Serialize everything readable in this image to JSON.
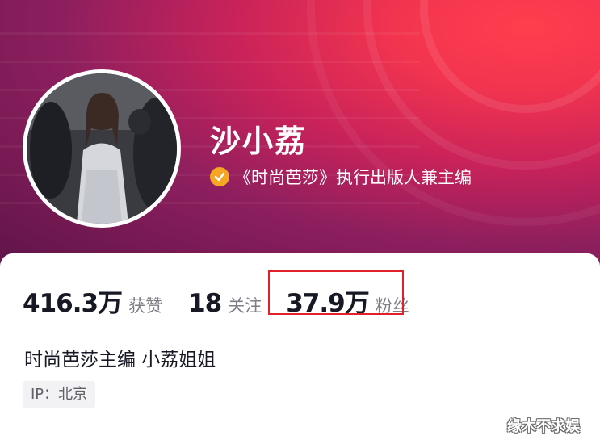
{
  "profile": {
    "name": "沙小荔",
    "verification": "《时尚芭莎》执行出版人兼主编"
  },
  "stats": {
    "likes_value": "416.3万",
    "likes_label": "获赞",
    "following_value": "18",
    "following_label": "关注",
    "fans_value": "37.9万",
    "fans_label": "粉丝"
  },
  "bio": "时尚芭莎主编 小荔姐姐",
  "ip_location": "IP：北京",
  "watermark": "缘木不求娱",
  "colors": {
    "verify_badge": "#f5a623",
    "highlight_box": "#e0202a",
    "header_start": "#ff3e4d",
    "header_end": "#5d1448"
  }
}
